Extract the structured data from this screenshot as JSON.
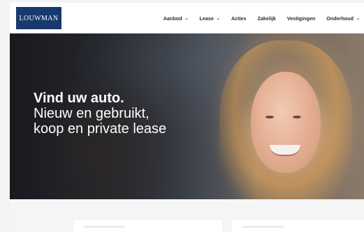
{
  "header": {
    "logo_text": "LOUWMAN",
    "nav": [
      {
        "label": "Aanbod",
        "dropdown": true
      },
      {
        "label": "Lease",
        "dropdown": true
      },
      {
        "label": "Acties",
        "dropdown": false
      },
      {
        "label": "Zakelijk",
        "dropdown": false
      },
      {
        "label": "Vestigingen",
        "dropdown": false
      },
      {
        "label": "Onderhoud",
        "dropdown": true
      }
    ],
    "chevron": "⌄"
  },
  "hero": {
    "title": "Vind uw auto.",
    "subtitle_line1": "Nieuw en gebruikt,",
    "subtitle_line2": "koop en private lease"
  },
  "colors": {
    "brand": "#173a6e",
    "nav_text": "#1f2a3a",
    "page_bg": "#f5f5f5"
  },
  "icons": {
    "dropdown": "chevron-down-icon"
  }
}
